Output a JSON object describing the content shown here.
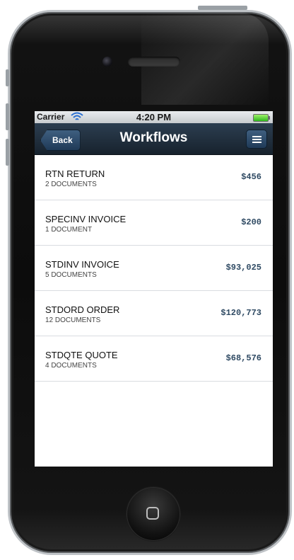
{
  "status_bar": {
    "carrier": "Carrier",
    "time": "4:20 PM"
  },
  "nav": {
    "back_label": "Back",
    "title": "Workflows"
  },
  "workflows": [
    {
      "title": "RTN RETURN",
      "subtitle": "2 DOCUMENTS",
      "amount": "$456"
    },
    {
      "title": "SPECINV INVOICE",
      "subtitle": "1 DOCUMENT",
      "amount": "$200"
    },
    {
      "title": "STDINV INVOICE",
      "subtitle": "5 DOCUMENTS",
      "amount": "$93,025"
    },
    {
      "title": "STDORD ORDER",
      "subtitle": "12 DOCUMENTS",
      "amount": "$120,773"
    },
    {
      "title": "STDQTE QUOTE",
      "subtitle": "4 DOCUMENTS",
      "amount": "$68,576"
    }
  ],
  "icons": {
    "wifi": "wifi-icon",
    "battery": "battery-icon",
    "menu": "hamburger-menu-icon",
    "home": "home-button-icon"
  },
  "colors": {
    "nav_bar": "#1f2d3a",
    "amount_text": "#2f4a63",
    "battery_fill": "#3cc82a"
  }
}
